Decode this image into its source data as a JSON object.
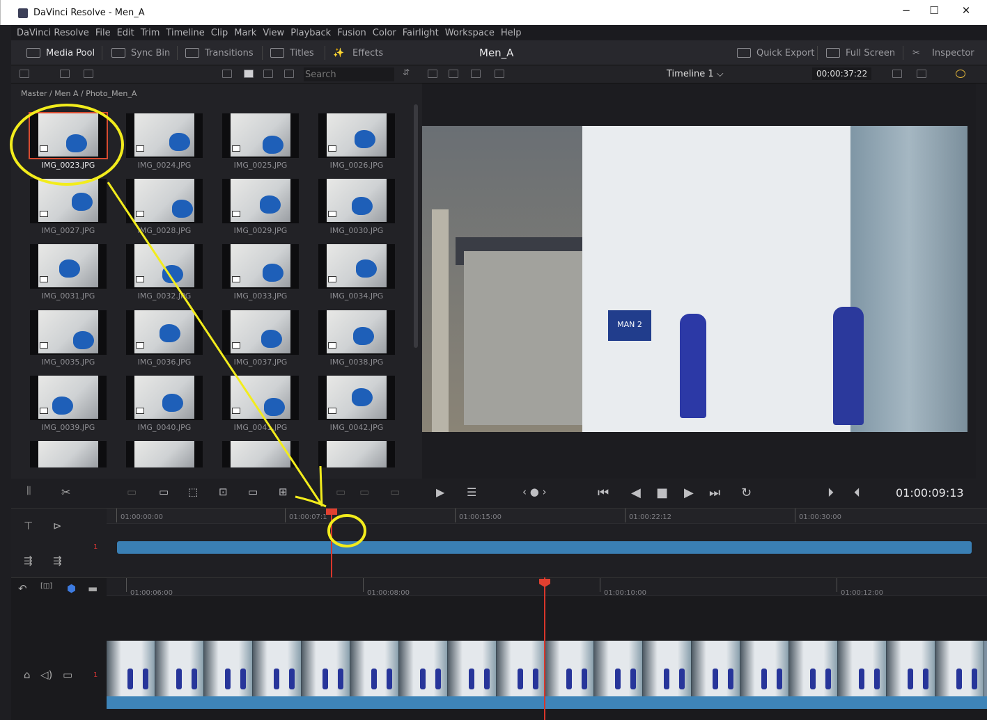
{
  "window": {
    "title": "DaVinci Resolve - Men_A",
    "minimize": "−",
    "maximize": "☐",
    "close": "✕"
  },
  "menu": [
    "DaVinci Resolve",
    "File",
    "Edit",
    "Trim",
    "Timeline",
    "Clip",
    "Mark",
    "View",
    "Playback",
    "Fusion",
    "Color",
    "Fairlight",
    "Workspace",
    "Help"
  ],
  "toolbar": {
    "media_pool": "Media Pool",
    "sync_bin": "Sync Bin",
    "transitions": "Transitions",
    "titles": "Titles",
    "effects": "Effects",
    "project": "Men_A",
    "quick_export": "Quick Export",
    "full_screen": "Full Screen",
    "inspector": "Inspector"
  },
  "subbar": {
    "search_placeholder": "Search",
    "timeline_name": "Timeline 1 ⌵",
    "duration": "00:00:37:22"
  },
  "media_pool": {
    "breadcrumb": "Master / Men A / Photo_Men_A",
    "clips": [
      "IMG_0023.JPG",
      "IMG_0024.JPG",
      "IMG_0025.JPG",
      "IMG_0026.JPG",
      "IMG_0027.JPG",
      "IMG_0028.JPG",
      "IMG_0029.JPG",
      "IMG_0030.JPG",
      "IMG_0031.JPG",
      "IMG_0032.JPG",
      "IMG_0033.JPG",
      "IMG_0034.JPG",
      "IMG_0035.JPG",
      "IMG_0036.JPG",
      "IMG_0037.JPG",
      "IMG_0038.JPG",
      "IMG_0039.JPG",
      "IMG_0040.JPG",
      "IMG_0041.JPG",
      "IMG_0042.JPG"
    ],
    "selected": "IMG_0023.JPG"
  },
  "viewer": {
    "sign_text": "MAN 2",
    "timecode": "01:00:09:13"
  },
  "timeline_upper": {
    "ruler": [
      "01:00:00:00",
      "01:00:07:1",
      "01:00:15:00",
      "01:00:22:12",
      "01:00:30:00"
    ],
    "track_number": "1"
  },
  "timeline_lower": {
    "ruler": [
      "01:00:06:00",
      "01:00:08:00",
      "01:00:10:00",
      "01:00:12:00"
    ],
    "track_number": "1"
  },
  "colors": {
    "annotation": "#f2ec1c",
    "playhead": "#d9362b",
    "clip_blue": "#3a7fb4",
    "selection": "#d74b30"
  }
}
